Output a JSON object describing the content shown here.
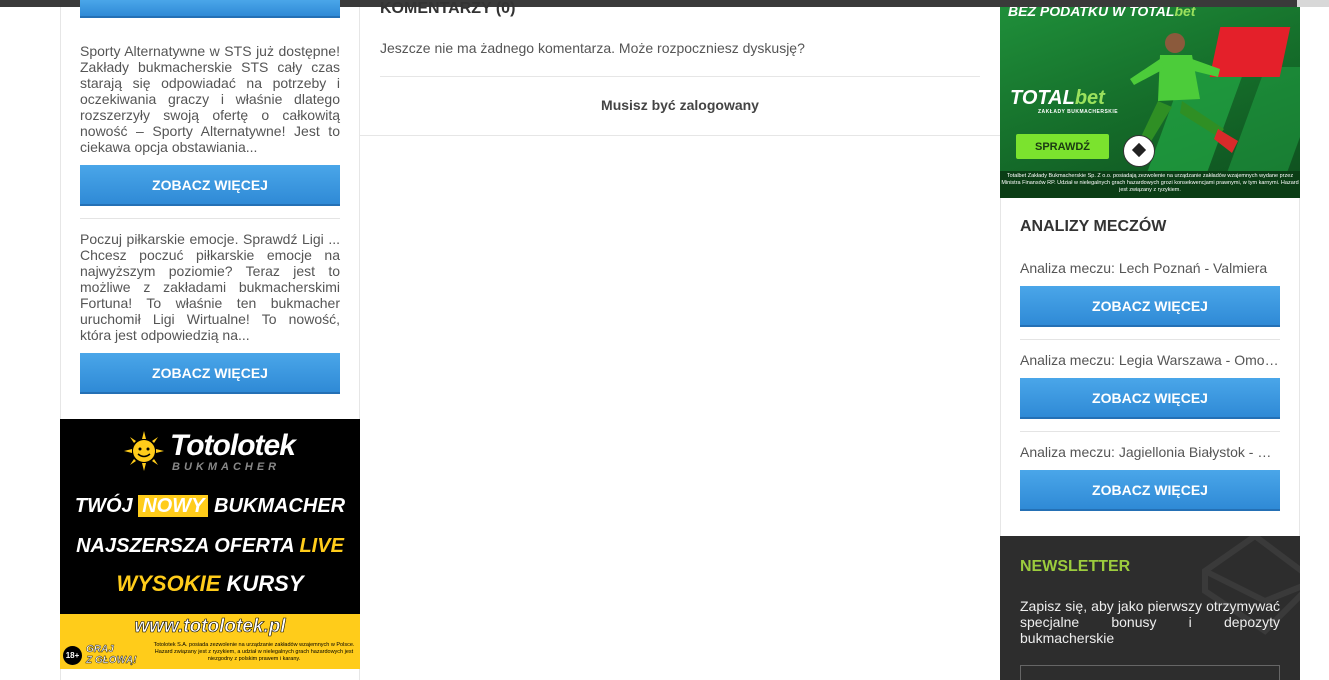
{
  "left_sidebar": {
    "top_button_label": "",
    "articles": [
      {
        "excerpt": "Sporty Alternatywne w STS już dostępne! Zakłady bukmacherskie STS cały czas starają się odpowiadać na potrzeby i oczekiwania graczy i właśnie dlatego rozszerzyły swoją ofertę o całkowitą nowość – Sporty Alternatywne! Jest to ciekawa opcja obstawiania...",
        "button_label": "ZOBACZ WIĘCEJ"
      },
      {
        "excerpt": "Poczuj piłkarskie emocje. Sprawdź Ligi ... Chcesz poczuć piłkarskie emocje na najwyższym poziomie? Teraz jest to możliwe z zakładami bukmacherskimi Fortuna! To właśnie ten bukmacher uruchomił Ligi Wirtualne! To nowość, która jest odpowiedzią na...",
        "button_label": "ZOBACZ WIĘCEJ"
      }
    ]
  },
  "totolotek_ad": {
    "brand": "Totolotek",
    "brand_sub": "BUKMACHER",
    "line1_a": "TWÓJ",
    "line1_b": "NOWY",
    "line1_c": "BUKMACHER",
    "line2_a": "NAJSZERSZA OFERTA",
    "line2_b": "LIVE",
    "line3_a": "WYSOKIE",
    "line3_b": "KURSY",
    "url": "www.totolotek.pl",
    "age": "18+",
    "graj_1": "GRAJ",
    "graj_2": "Z GŁOWĄ!",
    "legal": "Totolotek S.A. posiada zezwolenie na urządzanie zakładów wzajemnych w Polsce. Hazard związany jest z ryzykiem, a udział w nielegalnych grach hazardowych jest niezgodny z polskim prawem i karany.",
    "colors": {
      "yellow": "#ffcc1a",
      "black": "#000000"
    }
  },
  "comments": {
    "title": "KOMENTARZY (0)",
    "empty_text": "Jeszcze nie ma żadnego komentarza. Może rozpoczniesz dyskusję?",
    "login_text": "Musisz być zalogowany"
  },
  "totalbet_ad": {
    "header_a": "BEZ PODATKU W TOTAL",
    "header_b": "bet",
    "brand_a": "TOTAL",
    "brand_b": "bet",
    "brand_sub": "ZAKŁADY BUKMACHERSKIE",
    "cta": "SPRAWDŹ",
    "legal": "Totalbet Zakłady Bukmacherskie Sp. Z o.o. posiadają zezwolenie na urządzanie zakładów wzajemnych wydane przez Ministra Finansów RP. Udział w nielegalnych grach hazardowych grozi konsekwencjami prawnymi, w tym karnymi. Hazard jest związany z ryzykiem."
  },
  "analizy": {
    "title": "ANALIZY MECZÓW",
    "items": [
      {
        "label": "Analiza meczu: Lech Poznań - Valmiera",
        "button_label": "ZOBACZ WIĘCEJ"
      },
      {
        "label": "Analiza meczu: Legia Warszawa - Omonia Nikozja",
        "button_label": "ZOBACZ WIĘCEJ"
      },
      {
        "label": "Analiza meczu: Jagiellonia Białystok - Wisła Płock",
        "button_label": "ZOBACZ WIĘCEJ"
      }
    ]
  },
  "newsletter": {
    "title": "NEWSLETTER",
    "description": "Zapisz się, aby jako pierwszy otrzymywać specjalne bonusy i depozyty bukmacherskie",
    "input_placeholder": ""
  },
  "theme": {
    "button_blue": "#3a97df",
    "newsletter_green": "#9ccc3d",
    "newsletter_bg": "#2d2d2d"
  }
}
